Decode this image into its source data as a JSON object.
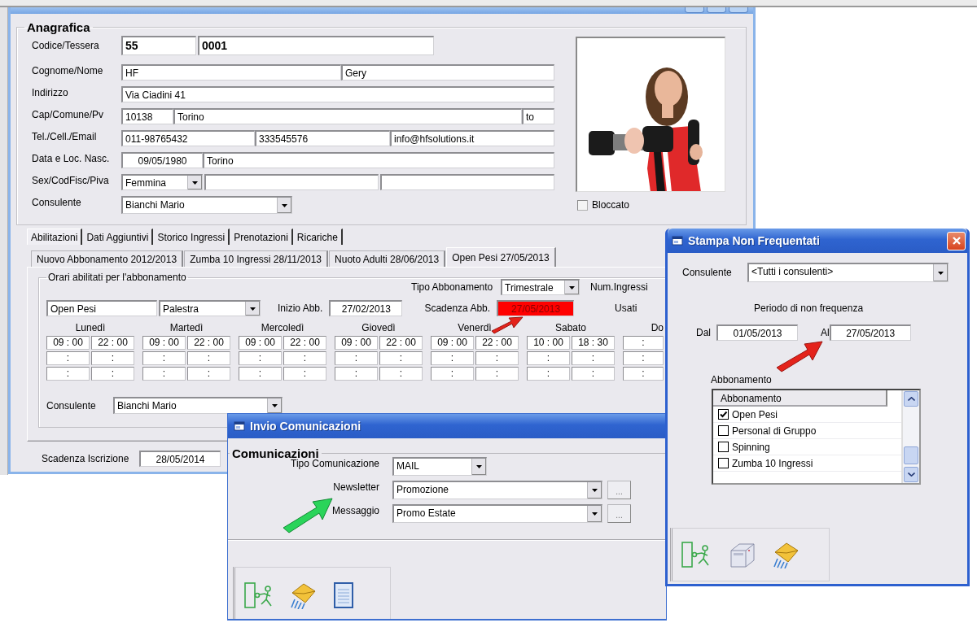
{
  "main_window": {
    "anagrafica": {
      "title": "Anagrafica",
      "rows": [
        {
          "label": "Codice/Tessera",
          "fields": [
            {
              "kind": "bold",
              "value": "55"
            },
            {
              "kind": "bold",
              "value": "0001"
            }
          ]
        },
        {
          "label": "Cognome/Nome",
          "fields": [
            {
              "kind": "text",
              "value": "HF"
            },
            {
              "kind": "text",
              "value": "Gery"
            }
          ]
        },
        {
          "label": "Indirizzo",
          "fields": [
            {
              "kind": "text",
              "value": "Via Ciadini 41"
            }
          ]
        },
        {
          "label": "Cap/Comune/Pv",
          "fields": [
            {
              "kind": "text",
              "value": "10138"
            },
            {
              "kind": "text",
              "value": "Torino"
            },
            {
              "kind": "text",
              "value": "to"
            }
          ]
        },
        {
          "label": "Tel./Cell./Email",
          "fields": [
            {
              "kind": "text",
              "value": "011-98765432"
            },
            {
              "kind": "text",
              "value": "333545576"
            },
            {
              "kind": "text",
              "value": "info@hfsolutions.it"
            }
          ]
        },
        {
          "label": "Data e Loc. Nasc.",
          "fields": [
            {
              "kind": "date",
              "value": "09/05/1980"
            },
            {
              "kind": "text",
              "value": "Torino"
            }
          ]
        },
        {
          "label": "Sex/CodFisc/Piva",
          "fields": [
            {
              "kind": "combo",
              "value": "Femmina"
            },
            {
              "kind": "text"
            },
            {
              "kind": "text"
            }
          ]
        },
        {
          "label": "Consulente",
          "fields": [
            {
              "kind": "combo",
              "value": "Bianchi Mario"
            }
          ]
        }
      ]
    },
    "bloccato": {
      "label": "Bloccato",
      "checked": false
    },
    "tabs": [
      {
        "label": "Abilitazioni",
        "selected": true
      },
      {
        "label": "Dati Aggiuntivi",
        "selected": false
      },
      {
        "label": "Storico Ingressi",
        "selected": false
      },
      {
        "label": "Prenotazioni",
        "selected": false
      },
      {
        "label": "Ricariche",
        "selected": false
      }
    ],
    "subtabs": [
      {
        "label": "Nuovo Abbonamento 2012/2013",
        "selected": false
      },
      {
        "label": "Zumba 10 Ingressi 28/11/2013",
        "selected": false
      },
      {
        "label": "Nuoto Adulti 28/06/2013",
        "selected": false
      },
      {
        "label": "Open Pesi 27/05/2013",
        "selected": true
      }
    ],
    "schedule": {
      "title": "Orari abilitati per l'abbonamento",
      "tipo_label": "Tipo Abbonamento",
      "tipo": "Trimestrale",
      "num_ingressi_label": "Num.Ingressi",
      "name": "Open Pesi",
      "location": "Palestra",
      "inizio_label": "Inizio Abb.",
      "inizio": "27/02/2013",
      "scadenza_label": "Scadenza Abb.",
      "scadenza": "27/05/2013",
      "expired": true,
      "usati_label": "Usati",
      "days": [
        {
          "name": "Lunedì",
          "slots": [
            [
              "09 : 00",
              "22 : 00"
            ],
            [
              ":",
              ":"
            ],
            [
              ":",
              ":"
            ]
          ]
        },
        {
          "name": "Martedì",
          "slots": [
            [
              "09 : 00",
              "22 : 00"
            ],
            [
              ":",
              ":"
            ],
            [
              ":",
              ":"
            ]
          ]
        },
        {
          "name": "Mercoledì",
          "slots": [
            [
              "09 : 00",
              "22 : 00"
            ],
            [
              ":",
              ":"
            ],
            [
              ":",
              ":"
            ]
          ]
        },
        {
          "name": "Giovedì",
          "slots": [
            [
              "09 : 00",
              "22 : 00"
            ],
            [
              ":",
              ":"
            ],
            [
              ":",
              ":"
            ]
          ]
        },
        {
          "name": "Venerdì",
          "slots": [
            [
              "09 : 00",
              "22 : 00"
            ],
            [
              ":",
              ":"
            ],
            [
              ":",
              ":"
            ]
          ]
        },
        {
          "name": "Sabato",
          "slots": [
            [
              "10 : 00",
              "18 : 30"
            ],
            [
              ":",
              ":"
            ],
            [
              ":",
              ":"
            ]
          ]
        },
        {
          "name": "Do",
          "slots": [
            [
              ":"
            ],
            [
              ":"
            ],
            [
              ":"
            ]
          ]
        }
      ],
      "consulente_label": "Consulente",
      "consulente": "Bianchi Mario"
    },
    "scadenza_iscrizione": {
      "label": "Scadenza Iscrizione",
      "value": "28/05/2014"
    }
  },
  "invio_dialog": {
    "title": "Invio Comunicazioni",
    "group": "Comunicazioni",
    "rows": [
      {
        "label": "Tipo Comunicazione",
        "value": "MAIL"
      },
      {
        "label": "Newsletter",
        "value": "Promozione",
        "more": "..."
      },
      {
        "label": "Messaggio",
        "value": "Promo Estate",
        "more": "..."
      }
    ],
    "toolbar": [
      {
        "kind": "exit"
      },
      {
        "kind": "mail"
      },
      {
        "kind": "document"
      }
    ]
  },
  "stampa_dialog": {
    "title": "Stampa Non Frequentati",
    "consulente_label": "Consulente",
    "consulente": "<Tutti i consulenti>",
    "period_title": "Periodo di non frequenza",
    "from_label": "Dal",
    "from": "01/05/2013",
    "to_label": "Al",
    "to": "27/05/2013",
    "list_label": "Abbonamento",
    "list_header": "Abbonamento",
    "items": [
      {
        "label": "Open Pesi",
        "checked": true
      },
      {
        "label": "Personal di Gruppo",
        "checked": false
      },
      {
        "label": "Spinning",
        "checked": false
      },
      {
        "label": "Zumba 10 Ingressi",
        "checked": false
      }
    ],
    "toolbar": [
      {
        "kind": "exit"
      },
      {
        "kind": "printer"
      },
      {
        "kind": "mail"
      }
    ]
  }
}
